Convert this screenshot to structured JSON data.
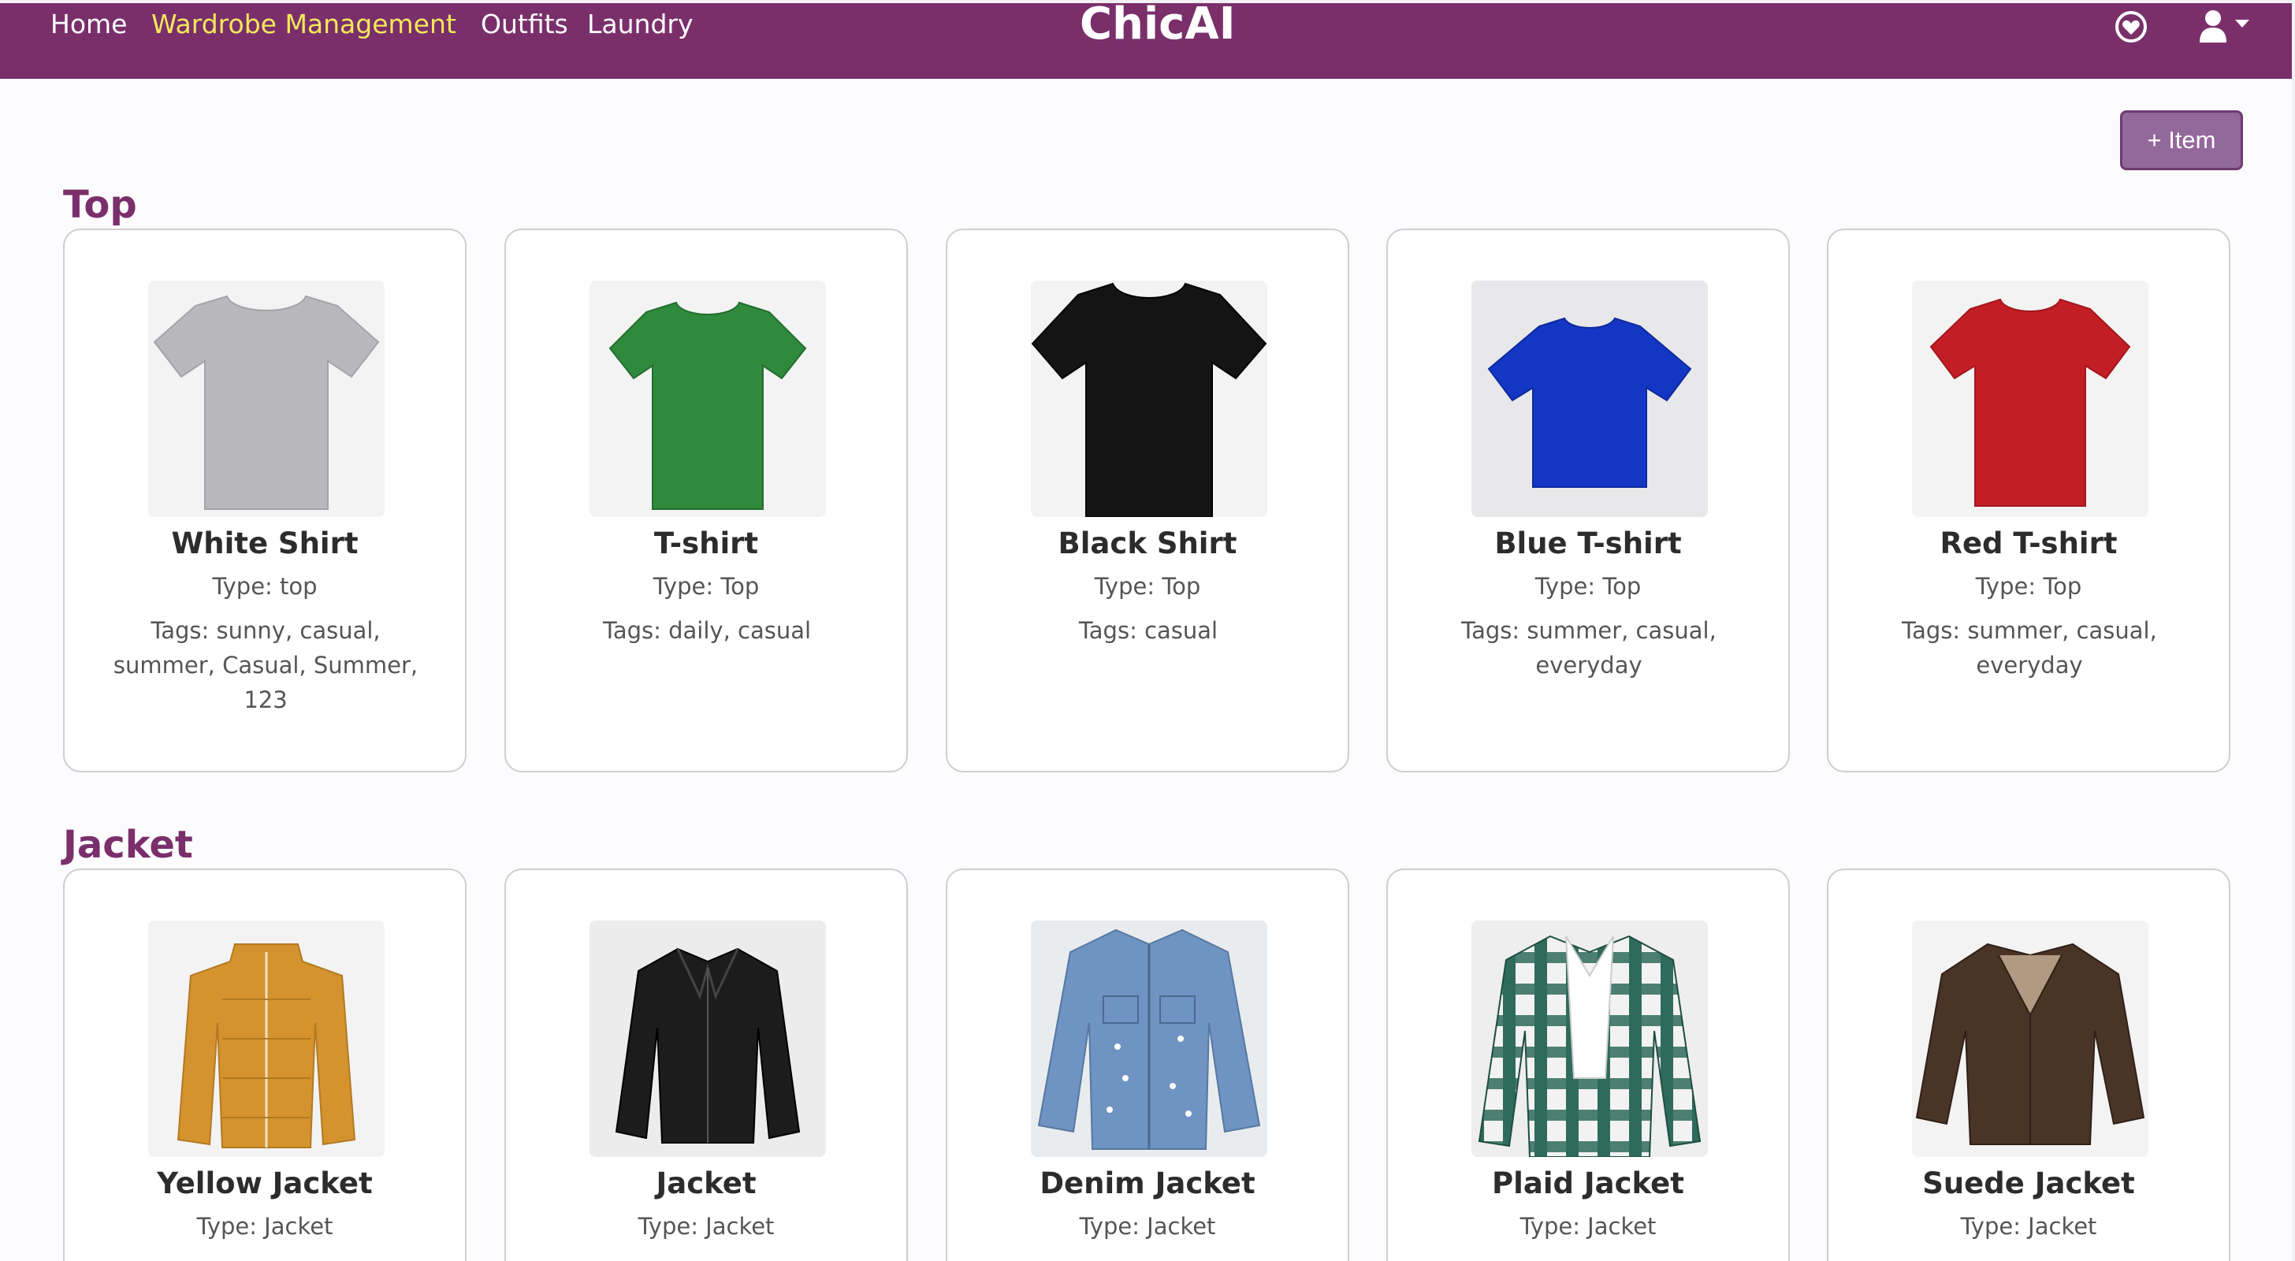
{
  "nav": {
    "links": [
      "Home",
      "Wardrobe Management",
      "Outfits",
      "Laundry"
    ],
    "brand": "ChicAI",
    "heart_icon": "heart-circle-icon",
    "user_icon": "user-icon",
    "caret_icon": "caret-down-icon",
    "accent_color": "#7a2f6b",
    "active_link_color": "#f4e85a"
  },
  "add_item_label": "+ Item",
  "sections": [
    {
      "title": "Top",
      "items": [
        {
          "name": "White Shirt",
          "type": "Type: top",
          "tags": "Tags: sunny, casual, summer, Casual, Summer, 123",
          "icon": "tshirt-icon",
          "color": "#b9b9bd"
        },
        {
          "name": "T-shirt",
          "type": "Type: Top",
          "tags": "Tags: daily, casual",
          "icon": "tshirt-icon",
          "color": "#2f8a3d"
        },
        {
          "name": "Black Shirt",
          "type": "Type: Top",
          "tags": "Tags: casual",
          "icon": "tshirt-icon",
          "color": "#141414"
        },
        {
          "name": "Blue T-shirt",
          "type": "Type: Top",
          "tags": "Tags: summer, casual, everyday",
          "icon": "tshirt-icon",
          "color": "#1436c4"
        },
        {
          "name": "Red T-shirt",
          "type": "Type: Top",
          "tags": "Tags: summer, casual, everyday",
          "icon": "tshirt-icon",
          "color": "#c41e25"
        }
      ]
    },
    {
      "title": "Jacket",
      "items": [
        {
          "name": "Yellow Jacket",
          "type": "Type: Jacket",
          "icon": "puffer-jacket-icon",
          "color": "#d4932e"
        },
        {
          "name": "Jacket",
          "type": "Type: Jacket",
          "icon": "leather-jacket-icon",
          "color": "#1c1c1c"
        },
        {
          "name": "Denim Jacket",
          "type": "Type: Jacket",
          "icon": "denim-jacket-icon",
          "color": "#6f93c2"
        },
        {
          "name": "Plaid Jacket",
          "type": "Type: Jacket",
          "icon": "plaid-jacket-icon",
          "color": "#2f6b5a"
        },
        {
          "name": "Suede Jacket",
          "type": "Type: Jacket",
          "icon": "suede-jacket-icon",
          "color": "#4a3426"
        }
      ]
    }
  ]
}
